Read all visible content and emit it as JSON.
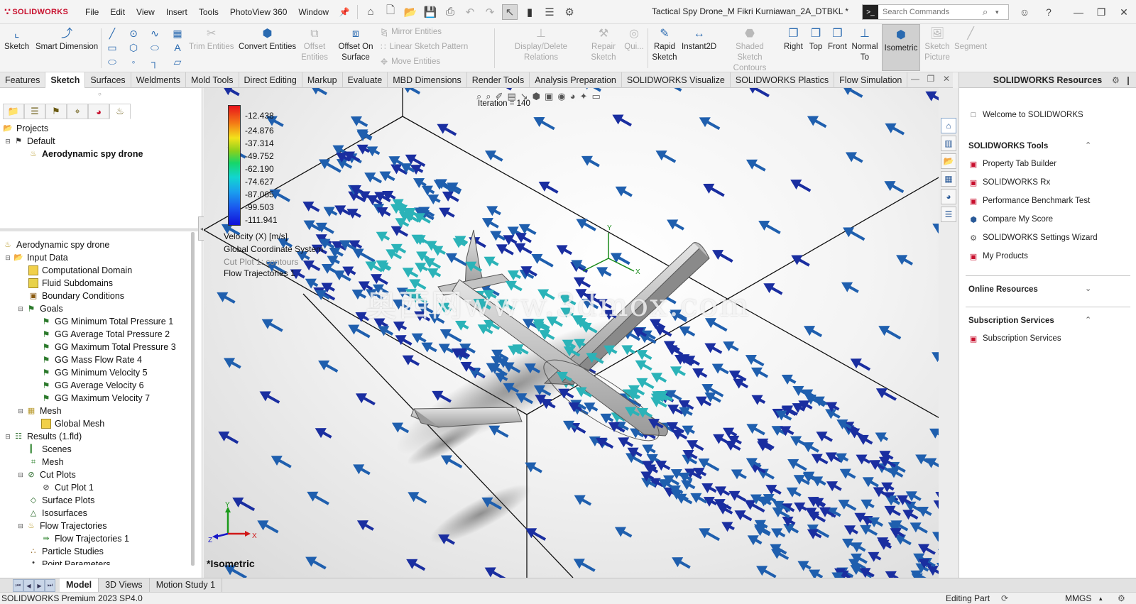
{
  "app": {
    "brand": "SOLIDWORKS",
    "menu": [
      "File",
      "Edit",
      "View",
      "Insert",
      "Tools",
      "PhotoView 360",
      "Window"
    ],
    "document_title": "Tactical Spy Drone_M Fikri Kurniawan_2A_DTBKL *",
    "search_placeholder": "Search Commands"
  },
  "ribbon": {
    "sketch": "Sketch",
    "smart_dimension": "Smart Dimension",
    "trim_entities": "Trim Entities",
    "convert_entities": "Convert Entities",
    "offset_entities": "Offset Entities",
    "offset_on_surface": "Offset On Surface",
    "mirror_entities": "Mirror Entities",
    "linear_sketch_pattern": "Linear Sketch Pattern",
    "move_entities": "Move Entities",
    "display_delete_relations": "Display/Delete Relations",
    "repair_sketch": "Repair Sketch",
    "quick_snaps": "Qui...",
    "rapid_sketch": "Rapid Sketch",
    "instant2d": "Instant2D",
    "shaded_sketch_contours": "Shaded Sketch Contours",
    "right": "Right",
    "top": "Top",
    "front": "Front",
    "normal_to": "Normal To",
    "isometric": "Isometric",
    "sketch_picture": "Sketch Picture",
    "segment": "Segment"
  },
  "tabs": [
    "Features",
    "Sketch",
    "Surfaces",
    "Weldments",
    "Mold Tools",
    "Direct Editing",
    "Markup",
    "Evaluate",
    "MBD Dimensions",
    "Render Tools",
    "Analysis Preparation",
    "SOLIDWORKS Visualize",
    "SOLIDWORKS Plastics",
    "Flow Simulation"
  ],
  "active_tab": "Sketch",
  "tree_top": {
    "projects": "Projects",
    "default": "Default",
    "project_name": "Aerodynamic spy drone"
  },
  "tree": {
    "root": "Aerodynamic spy drone",
    "input_data": "Input Data",
    "computational_domain": "Computational Domain",
    "fluid_subdomains": "Fluid Subdomains",
    "boundary_conditions": "Boundary Conditions",
    "goals": "Goals",
    "goal_items": [
      "GG Minimum Total Pressure 1",
      "GG Average Total Pressure 2",
      "GG Maximum Total Pressure 3",
      "GG Mass Flow Rate 4",
      "GG Minimum Velocity 5",
      "GG Average Velocity 6",
      "GG Maximum Velocity 7"
    ],
    "mesh": "Mesh",
    "global_mesh": "Global Mesh",
    "results": "Results (1.fld)",
    "scenes": "Scenes",
    "results_mesh": "Mesh",
    "cut_plots": "Cut Plots",
    "cut_plot_1": "Cut Plot 1",
    "surface_plots": "Surface Plots",
    "isosurfaces": "Isosurfaces",
    "flow_trajectories": "Flow Trajectories",
    "flow_trajectories_1": "Flow Trajectories 1",
    "particle_studies": "Particle Studies",
    "point_parameters": "Point Parameters"
  },
  "viewport": {
    "legend_values": [
      "-12.438",
      "-24.876",
      "-37.314",
      "-49.752",
      "-62.190",
      "-74.627",
      "-87.065",
      "-99.503",
      "-111.941"
    ],
    "legend_unit": "Velocity (X) [m/s]",
    "coord_system": "Global Coordinate System",
    "cut_plot_label": "Cut Plot 1: contours",
    "flow_traj_label": "Flow Trajectories 1",
    "iteration": "Iteration = 140",
    "view_name": "*Isometric",
    "watermark": "奥西网www.3dmox.com",
    "triad_labels": [
      "X",
      "Y",
      "Z"
    ]
  },
  "bottom_tabs": [
    "Model",
    "3D Views",
    "Motion Study 1"
  ],
  "active_bottom_tab": "Model",
  "status": {
    "product": "SOLIDWORKS Premium 2023 SP4.0",
    "mode": "Editing Part",
    "units": "MMGS"
  },
  "resources": {
    "header": "SOLIDWORKS Resources",
    "welcome": "Welcome to SOLIDWORKS",
    "tools_title": "SOLIDWORKS Tools",
    "tools": [
      "Property Tab Builder",
      "SOLIDWORKS Rx",
      "Performance Benchmark Test",
      "Compare My Score",
      "SOLIDWORKS Settings Wizard",
      "My Products"
    ],
    "online_title": "Online Resources",
    "subscription_title": "Subscription Services",
    "subscription_item": "Subscription Services"
  },
  "colors": {
    "brand_red": "#c8102e",
    "arrow_dark_blue": "#1a2ea0",
    "arrow_blue": "#1f5fae",
    "arrow_cyan": "#2bb3b8",
    "active_view_button": "#d0d0d0"
  }
}
